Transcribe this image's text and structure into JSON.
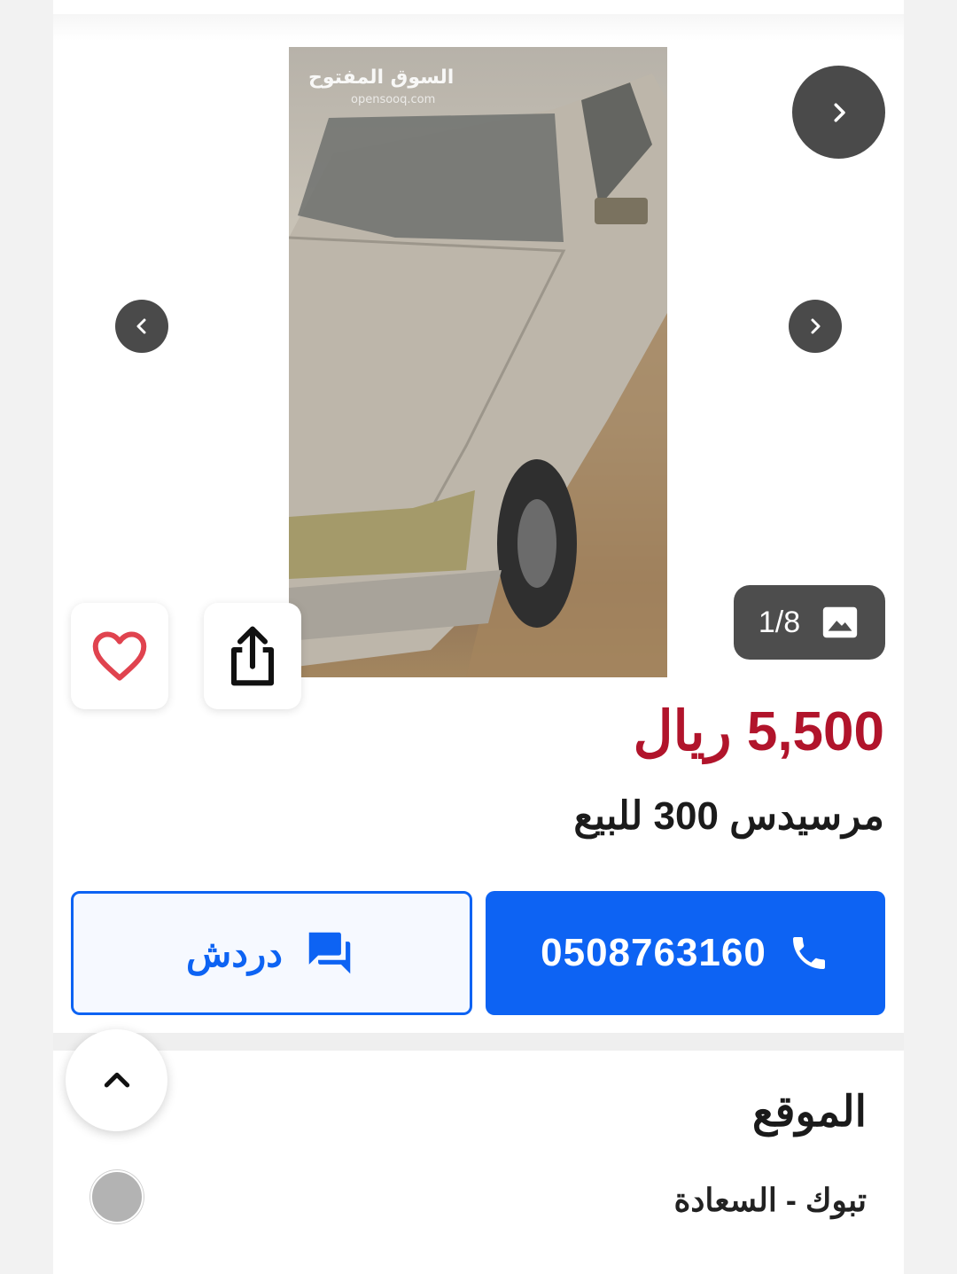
{
  "gallery": {
    "watermark": "السوق المفتوح",
    "watermark_sub": "opensooq.com",
    "counter": "1/8",
    "icons": {
      "next": "chevron-right-icon",
      "prev": "chevron-left-icon",
      "gallery": "image-icon"
    }
  },
  "actions": {
    "favorite_icon": "heart-icon",
    "share_icon": "share-icon"
  },
  "listing": {
    "price": "5,500 ريال",
    "title": "مرسيدس 300 للبيع"
  },
  "contact": {
    "phone": "0508763160",
    "chat_label": "دردش",
    "phone_icon": "phone-icon",
    "chat_icon": "chat-icon"
  },
  "location": {
    "section_title": "الموقع",
    "value": "تبوك - السعادة"
  },
  "colors": {
    "price": "#b1142b",
    "primary": "#0d63f3",
    "nav_button": "#4a4a4a"
  }
}
